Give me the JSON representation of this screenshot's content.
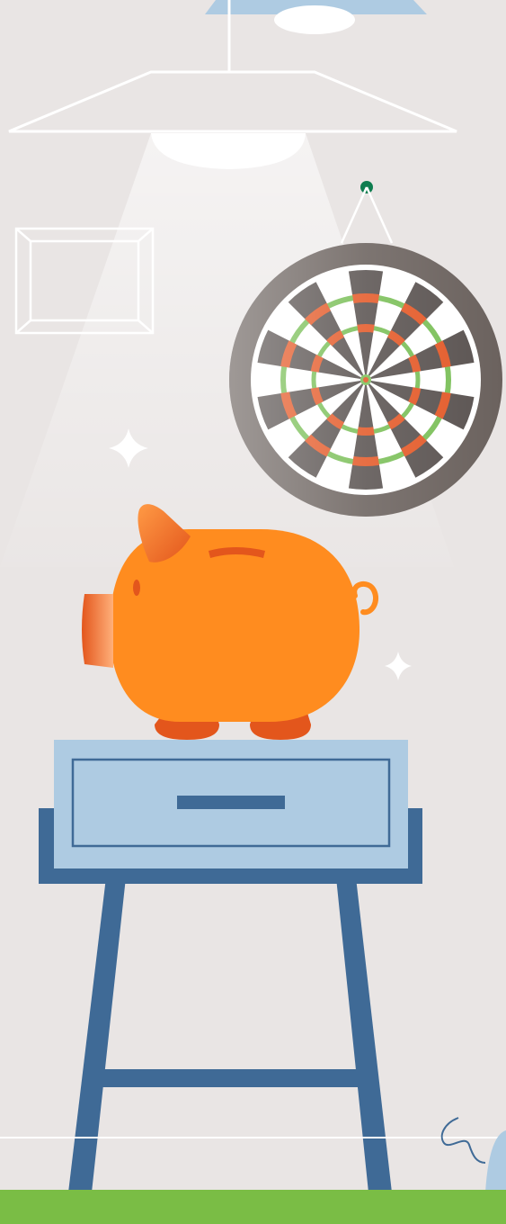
{
  "illustration": {
    "subject": "",
    "colors": {
      "background": "#e9e5e4",
      "wall_line": "#ffffff",
      "lamp_shade_top": "#aecbe2",
      "lamp_light": "#ffffff",
      "dartboard_frame": "#6b625e",
      "dartboard_dark": "#5b5452",
      "dartboard_light": "#ffffff",
      "dart_ring_red": "#e45b2a",
      "dart_ring_green": "#7cc05a",
      "dart_pin": "#0e7d4f",
      "piggy_body": "#ff8c1f",
      "piggy_shadow": "#e3561c",
      "nightstand_light": "#aecbe2",
      "nightstand_dark": "#3f6a96",
      "floor": "#7abd45",
      "sparkle": "#ffffff",
      "decor_curl": "#3f6a96"
    },
    "icons": [
      "ceiling-lamp-icon",
      "picture-frame-icon",
      "dartboard-icon",
      "piggy-bank-icon",
      "sparkle-icon",
      "nightstand-icon"
    ]
  }
}
